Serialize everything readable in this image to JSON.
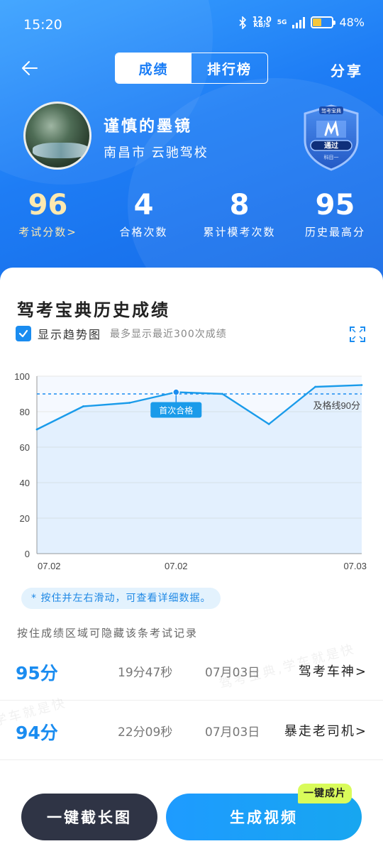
{
  "status_bar": {
    "time": "15:20",
    "net_speed": "12.0",
    "net_unit": "KB/S",
    "network": "5G",
    "battery": "48%"
  },
  "nav": {
    "tabs": [
      {
        "label": "成绩",
        "active": true
      },
      {
        "label": "排行榜",
        "active": false
      }
    ],
    "share_label": "分享"
  },
  "profile": {
    "name": "谨慎的墨镜",
    "location": "南昌市 云驰驾校",
    "badge": {
      "brand": "驾考宝典",
      "text": "通过",
      "subject": "科目一"
    }
  },
  "stats": [
    {
      "value": "96",
      "label": "考试分数>"
    },
    {
      "value": "4",
      "label": "合格次数"
    },
    {
      "value": "8",
      "label": "累计模考次数"
    },
    {
      "value": "95",
      "label": "历史最高分"
    }
  ],
  "history": {
    "title": "驾考宝典历史成绩",
    "trend_label": "显示趋势图",
    "trend_note": "最多显示最近300次成绩",
    "trend_checked": true
  },
  "chart_data": {
    "type": "line",
    "x_tick_labels": [
      "07.02",
      "07.02",
      "07.03"
    ],
    "y_ticks": [
      0,
      20,
      40,
      60,
      80,
      100
    ],
    "ylim": [
      0,
      100
    ],
    "values": [
      70,
      83,
      85,
      91,
      90,
      73,
      94,
      95
    ],
    "threshold": {
      "value": 90,
      "label": "及格线90分"
    },
    "annotation": {
      "label": "首次合格",
      "index": 3
    },
    "grid": true
  },
  "hint": "* 按住并左右滑动，可查看详细数据。",
  "hide_tip": "按住成绩区域可隐藏该条考试记录",
  "records": [
    {
      "score": "95分",
      "duration": "19分47秒",
      "date": "07月03日",
      "title": "驾考车神>"
    },
    {
      "score": "94分",
      "duration": "22分09秒",
      "date": "07月03日",
      "title": "暴走老司机>"
    }
  ],
  "watermark": {
    "text1": "驾考宝典,学车就是快",
    "text2": "学车就是快"
  },
  "buttons": {
    "screenshot": "一键截长图",
    "video": "生成视频",
    "video_tag": "一键成片"
  },
  "colors": {
    "accent": "#1a8cf0",
    "hero_top": "#3aa2ff",
    "hero_bottom": "#1469e6",
    "gold": "#fde9b0",
    "tag": "#d9fb5a"
  }
}
